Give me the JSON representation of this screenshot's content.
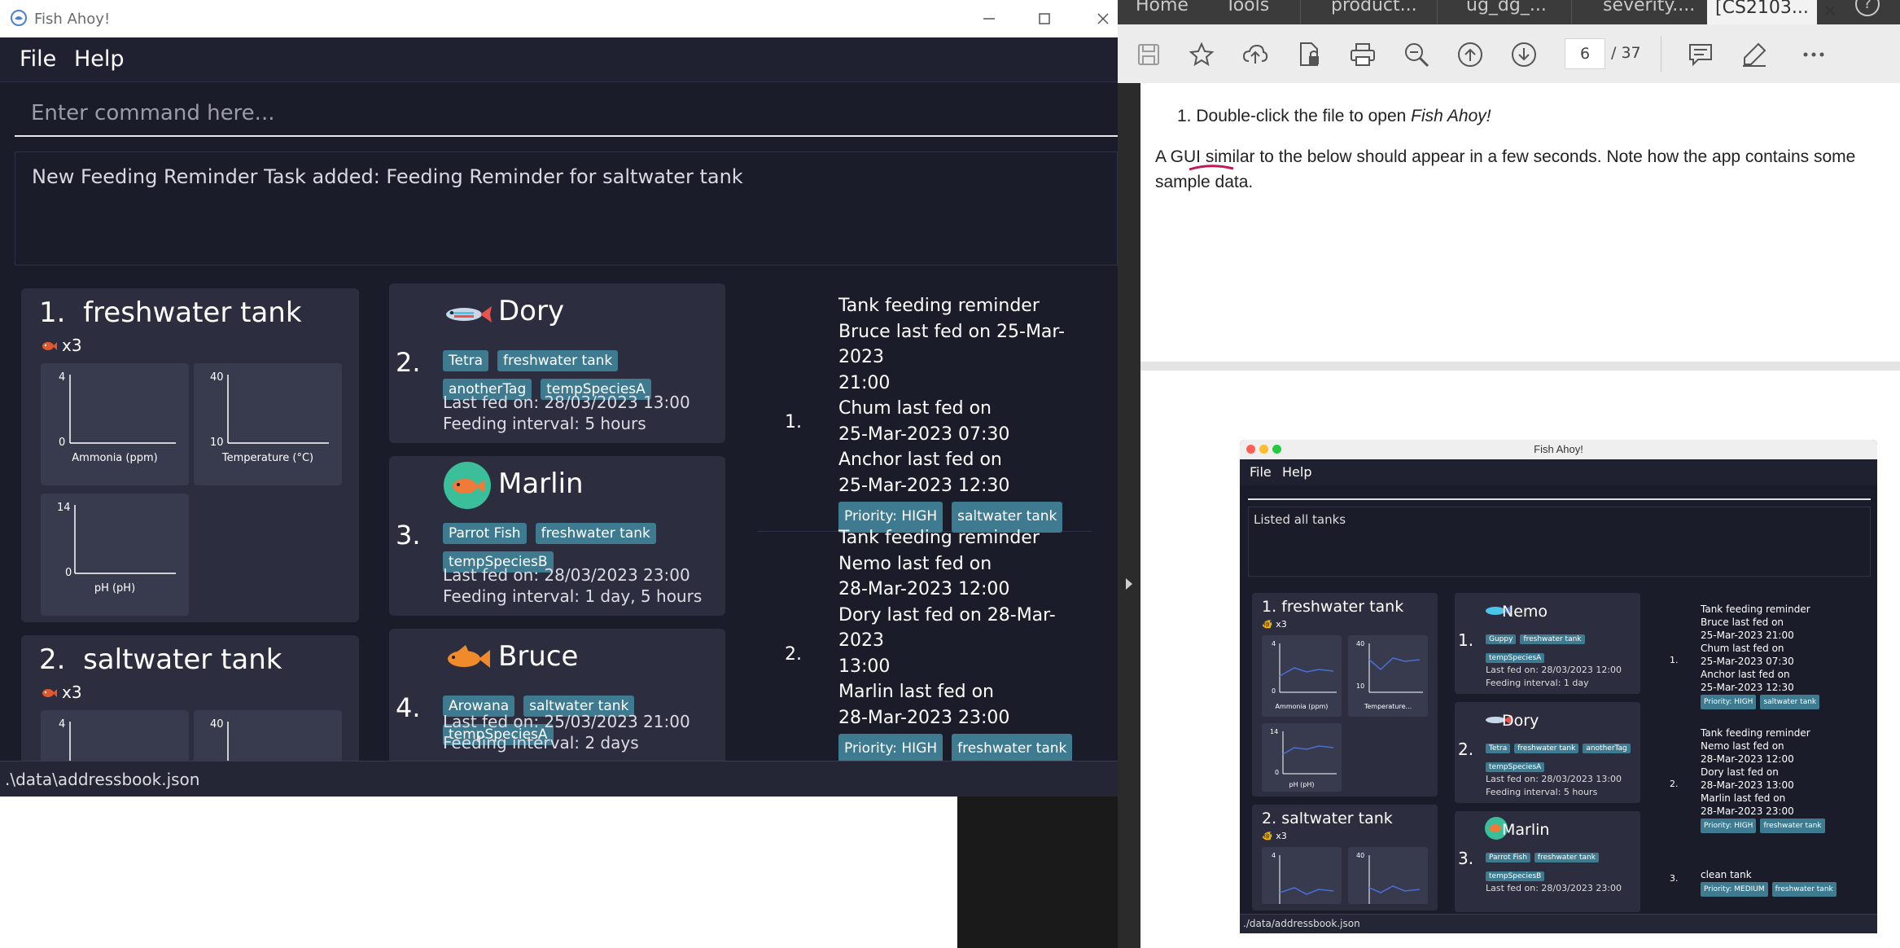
{
  "fish_ahoy_window": {
    "title": "Fish Ahoy!",
    "menu": [
      "File",
      "Help"
    ],
    "command_placeholder": "Enter command here...",
    "result_message": "New Feeding Reminder Task added: Feeding Reminder for saltwater tank",
    "status_path": ".\\data\\addressbook.json",
    "tanks": [
      {
        "index": "1.",
        "name": "freshwater tank",
        "fish_count": "x3",
        "graphs": [
          {
            "label": "Ammonia (ppm)",
            "y_max": "4",
            "y_min": "0"
          },
          {
            "label": "Temperature (°C)",
            "y_max": "40",
            "y_min": "10"
          },
          {
            "label": "pH (pH)",
            "y_max": "14",
            "y_min": "0"
          }
        ]
      },
      {
        "index": "2.",
        "name": "saltwater tank",
        "fish_count": "x3",
        "graphs": [
          {
            "y_max": "4"
          },
          {
            "y_max": "40"
          }
        ]
      }
    ],
    "fish": [
      {
        "index": "2.",
        "name": "Dory",
        "icon": "tetra-fish-icon",
        "tags": [
          "Tetra",
          "freshwater tank",
          "anotherTag",
          "tempSpeciesA"
        ],
        "last_fed": "Last fed on: 28/03/2023 13:00",
        "interval": "Feeding interval: 5 hours"
      },
      {
        "index": "3.",
        "name": "Marlin",
        "icon": "parrot-fish-icon",
        "tags": [
          "Parrot Fish",
          "freshwater tank",
          "tempSpeciesB"
        ],
        "last_fed": "Last fed on: 28/03/2023 23:00",
        "interval": "Feeding interval: 1 day, 5 hours"
      },
      {
        "index": "4.",
        "name": "Bruce",
        "icon": "arowana-fish-icon",
        "tags": [
          "Arowana",
          "saltwater tank",
          "tempSpeciesA"
        ],
        "last_fed": "Last fed on: 25/03/2023 21:00",
        "interval": "Feeding interval: 2 days"
      }
    ],
    "tasks": [
      {
        "index": "1.",
        "lines": [
          "Tank feeding reminder",
          "Bruce last fed on 25-Mar-2023",
          "21:00",
          "Chum last fed on",
          "25-Mar-2023 07:30",
          "Anchor last fed on",
          "25-Mar-2023 12:30"
        ],
        "tags": [
          "Priority: HIGH",
          "saltwater tank"
        ]
      },
      {
        "index": "2.",
        "lines": [
          "Tank feeding reminder",
          "Nemo last fed on",
          "28-Mar-2023 12:00",
          "Dory last fed on 28-Mar-2023",
          "13:00",
          "Marlin last fed on",
          "28-Mar-2023 23:00"
        ],
        "tags": [
          "Priority: HIGH",
          "freshwater tank"
        ]
      }
    ]
  },
  "pdf_viewer": {
    "tabs": [
      "Home",
      "Tools",
      "product...",
      "ug_dg_...",
      "severity....",
      "[CS2103..."
    ],
    "help_icon": "?",
    "current_page": "6",
    "page_total": "/  37",
    "step_number": "1.",
    "step_text_before": "Double-click the file to open ",
    "step_text_em": "Fish Ahoy!",
    "paragraph": "A GUI similar to the below should appear in a few seconds. Note how the app contains some",
    "paragraph_cont": "sample data.",
    "embedded_screenshot": {
      "title": "Fish Ahoy!",
      "menu": [
        "File",
        "Help"
      ],
      "result_message": "Listed all tanks",
      "status_path": "./data/addressbook.json",
      "tanks": [
        {
          "index": "1.",
          "name": "freshwater tank",
          "fish_count": "x3",
          "graphs": [
            {
              "label": "Ammonia (ppm)",
              "y_max": "4",
              "y_min": "0"
            },
            {
              "label": "Temperature...",
              "y_max": "40",
              "y_min": "10"
            },
            {
              "label": "pH (pH)",
              "y_max": "14",
              "y_min": "0"
            }
          ]
        },
        {
          "index": "2.",
          "name": "saltwater tank",
          "fish_count": "x3",
          "graphs": [
            {
              "y_max": "4"
            },
            {
              "y_max": "40"
            }
          ]
        }
      ],
      "fish": [
        {
          "index": "1.",
          "name": "Nemo",
          "tags": [
            "Guppy",
            "freshwater tank",
            "tempSpeciesA"
          ],
          "last_fed": "Last fed on: 28/03/2023 12:00",
          "interval": "Feeding interval: 1 day"
        },
        {
          "index": "2.",
          "name": "Dory",
          "tags": [
            "Tetra",
            "freshwater tank",
            "anotherTag",
            "tempSpeciesA"
          ],
          "last_fed": "Last fed on: 28/03/2023 13:00",
          "interval": "Feeding interval: 5 hours"
        },
        {
          "index": "3.",
          "name": "Marlin",
          "tags": [
            "Parrot Fish",
            "freshwater tank",
            "tempSpeciesB"
          ],
          "last_fed": "Last fed on: 28/03/2023 23:00",
          "interval": ""
        }
      ],
      "tasks": [
        {
          "index": "1.",
          "lines": [
            "Tank feeding reminder",
            "Bruce last fed on",
            "25-Mar-2023 21:00",
            "Chum last fed on",
            "25-Mar-2023 07:30",
            "Anchor last fed on",
            "25-Mar-2023 12:30"
          ],
          "tags": [
            "Priority: HIGH",
            "saltwater tank"
          ]
        },
        {
          "index": "2.",
          "lines": [
            "Tank feeding reminder",
            "Nemo last fed on",
            "28-Mar-2023 12:00",
            "Dory last fed on",
            "28-Mar-2023 13:00",
            "Marlin last fed on",
            "28-Mar-2023 23:00"
          ],
          "tags": [
            "Priority: HIGH",
            "freshwater tank"
          ]
        },
        {
          "index": "3.",
          "lines": [
            "clean tank"
          ],
          "tags": [
            "Priority: MEDIUM",
            "freshwater tank"
          ]
        }
      ]
    }
  }
}
